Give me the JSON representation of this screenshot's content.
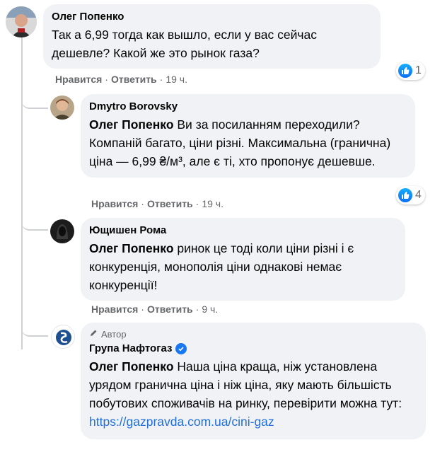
{
  "comments": [
    {
      "author": "Олег Попенко",
      "text": "Так а 6,99 тогда как вышло, если у вас сейчас дешевле? Какой же это рынок газа?",
      "like_label": "Нравится",
      "reply_label": "Ответить",
      "time": "19 ч.",
      "reactions": "1"
    },
    {
      "author": "Dmytro Borovsky",
      "mention": "Олег Попенко",
      "text": " Ви за посиланням переходили? Компаній багато, ціни різні. Максимальна (гранична) ціна — 6,99 ₴/м³, але є ті, хто пропонує дешевше.",
      "like_label": "Нравится",
      "reply_label": "Ответить",
      "time": "19 ч.",
      "reactions": "4"
    },
    {
      "author": "Ющишен Рома",
      "mention": "Олег Попенко",
      "text": " ринок це тоді коли ціни різні і є конкуренція, монополія ціни однакові немає конкуренції!",
      "like_label": "Нравится",
      "reply_label": "Ответить",
      "time": "9 ч."
    },
    {
      "badge": "Автор",
      "author": "Група Нафтогаз",
      "mention": "Олег Попенко",
      "text": " Наша ціна краща, ніж установлена урядом гранична ціна і ніж ціна, яку мають більшість побутових споживачів на ринку, перевірити можна тут:",
      "link": "https://gazpravda.com.ua/cini-gaz"
    }
  ],
  "colors": {
    "bubble": "#f0f2f5",
    "meta": "#65676b",
    "link": "#216fdb",
    "like": "#1877f2"
  },
  "icons": [
    "like-icon",
    "verified-badge-icon",
    "pencil-icon"
  ]
}
